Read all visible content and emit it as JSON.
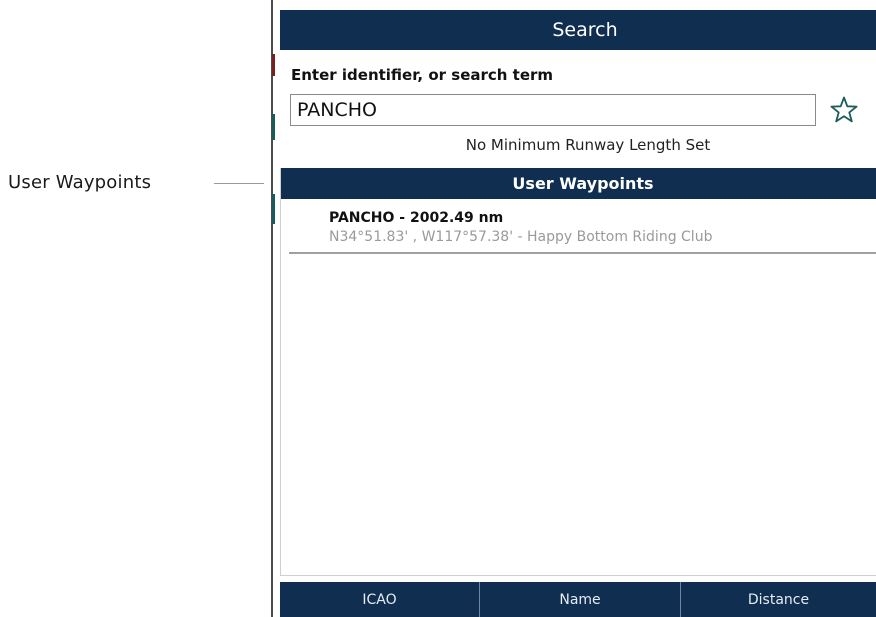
{
  "callout": {
    "label": "User Waypoints"
  },
  "search": {
    "title": "Search",
    "prompt": "Enter identifier, or search term",
    "query": "PANCHO",
    "favorite_icon": "star-outline-icon",
    "runway_note": "No Minimum Runway Length Set"
  },
  "results": {
    "section_title": "User Waypoints",
    "items": [
      {
        "title": "PANCHO - 2002.49 nm",
        "subtitle": "N34°51.83' , W117°57.38' - Happy Bottom Riding Club"
      }
    ]
  },
  "sort_tabs": [
    {
      "label": "ICAO"
    },
    {
      "label": "Name"
    },
    {
      "label": "Distance"
    }
  ],
  "colors": {
    "header_navy": "#0f2e50",
    "accent_green": "#1a5c5c",
    "muted_text": "#9a9a9a"
  }
}
